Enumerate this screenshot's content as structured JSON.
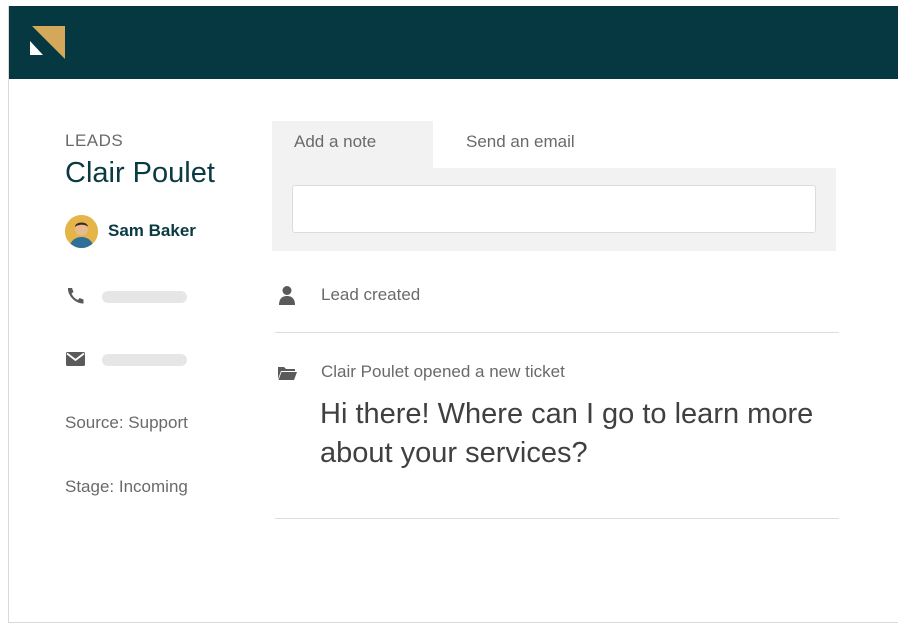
{
  "header": {
    "logo_icon": "brand-logo-icon",
    "background": "#063841",
    "accent": "#d4a85a"
  },
  "lead": {
    "breadcrumb": "LEADS",
    "name": "Clair Poulet",
    "owner": "Sam Baker",
    "phone_icon": "phone-icon",
    "email_icon": "envelope-icon",
    "source": "Source: Support",
    "stage": "Stage: Incoming"
  },
  "composer": {
    "tabs": [
      {
        "label": "Add a note",
        "active": true
      },
      {
        "label": "Send an email",
        "active": false
      }
    ],
    "note_value": ""
  },
  "activity": [
    {
      "icon": "person-icon",
      "text": "Lead created"
    },
    {
      "icon": "folder-icon",
      "text": "Clair Poulet opened a new ticket",
      "message": "Hi there! Where can I go to learn more about your services?"
    }
  ]
}
